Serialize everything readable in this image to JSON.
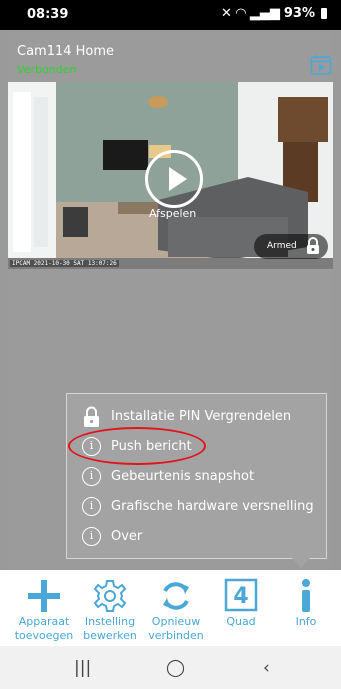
{
  "status_bar": {
    "time": "08:39",
    "battery": "93%"
  },
  "header": {
    "title": "Cam114 Home",
    "connection_status": "Verbonden"
  },
  "video": {
    "play_label": "Afspelen",
    "armed_label": "Armed",
    "osd_text": "IPCAM 2021-10-30 SAT 13:07:26"
  },
  "info_menu": {
    "items": [
      {
        "label": "Installatie PIN Vergrendelen",
        "icon": "lock-icon"
      },
      {
        "label": "Push bericht",
        "icon": "info-icon"
      },
      {
        "label": "Gebeurtenis snapshot",
        "icon": "info-icon"
      },
      {
        "label": "Grafische hardware versnelling",
        "icon": "info-icon"
      },
      {
        "label": "Over",
        "icon": "info-icon"
      }
    ],
    "highlight_color": "#e0151b"
  },
  "bottom_nav": {
    "items": [
      {
        "label": "Apparaat toevoegen",
        "icon": "plus-icon"
      },
      {
        "label": "Instelling bewerken",
        "icon": "gear-icon"
      },
      {
        "label": "Opnieuw verbinden",
        "icon": "refresh-icon"
      },
      {
        "label": "Quad",
        "icon": "quad-icon",
        "badge": "4"
      },
      {
        "label": "Info",
        "icon": "info-icon"
      }
    ],
    "accent_color": "#4aa8d8"
  }
}
